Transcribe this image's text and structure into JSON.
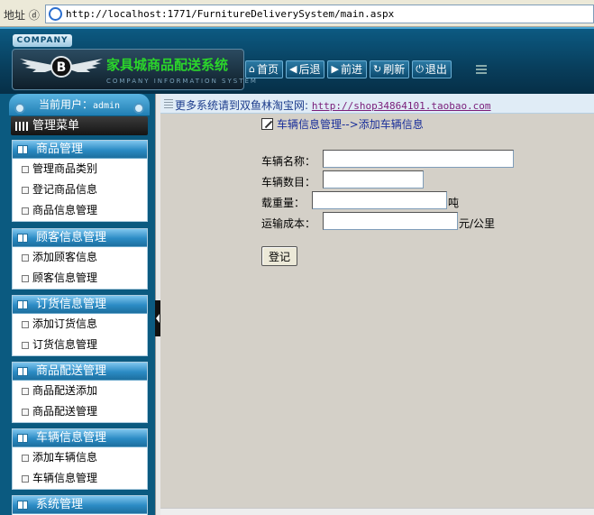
{
  "browser": {
    "address_label": "地址 ⓓ",
    "url": "http://localhost:1771/FurnitureDeliverySystem/main.aspx"
  },
  "header": {
    "company_tag": "COMPANY",
    "title": "家具城商品配送系统",
    "subtitle": "COMPANY INFORMATION SYSTEM",
    "nav": [
      {
        "label": "首页",
        "icon": "home-icon"
      },
      {
        "label": "后退",
        "icon": "back-arrow-icon"
      },
      {
        "label": "前进",
        "icon": "forward-arrow-icon"
      },
      {
        "label": "刷新",
        "icon": "refresh-icon"
      },
      {
        "label": "退出",
        "icon": "power-icon"
      }
    ]
  },
  "sidebar": {
    "user_prefix": "当前用户：",
    "user_name": "admin",
    "menu_title": "管理菜单",
    "groups": [
      {
        "title": "商品管理",
        "items": [
          "管理商品类别",
          "登记商品信息",
          "商品信息管理"
        ]
      },
      {
        "title": "顾客信息管理",
        "items": [
          "添加顾客信息",
          "顾客信息管理"
        ]
      },
      {
        "title": "订货信息管理",
        "items": [
          "添加订货信息",
          "订货信息管理"
        ]
      },
      {
        "title": "商品配送管理",
        "items": [
          "商品配送添加",
          "商品配送管理"
        ]
      },
      {
        "title": "车辆信息管理",
        "items": [
          "添加车辆信息",
          "车辆信息管理"
        ]
      },
      {
        "title": "系统管理",
        "items": []
      }
    ]
  },
  "info_bar": {
    "text": "更多系统请到双鱼林淘宝网:",
    "link": "http://shop34864101.taobao.com"
  },
  "breadcrumb": "车辆信息管理-->添加车辆信息",
  "form": {
    "name_label": "车辆名称：",
    "count_label": "车辆数目：",
    "load_label": "载重量：",
    "load_unit": "吨",
    "cost_label": "运输成本：",
    "cost_unit": "元/公里",
    "name_value": "",
    "count_value": "",
    "load_value": "",
    "cost_value": "",
    "submit_label": "登记"
  }
}
